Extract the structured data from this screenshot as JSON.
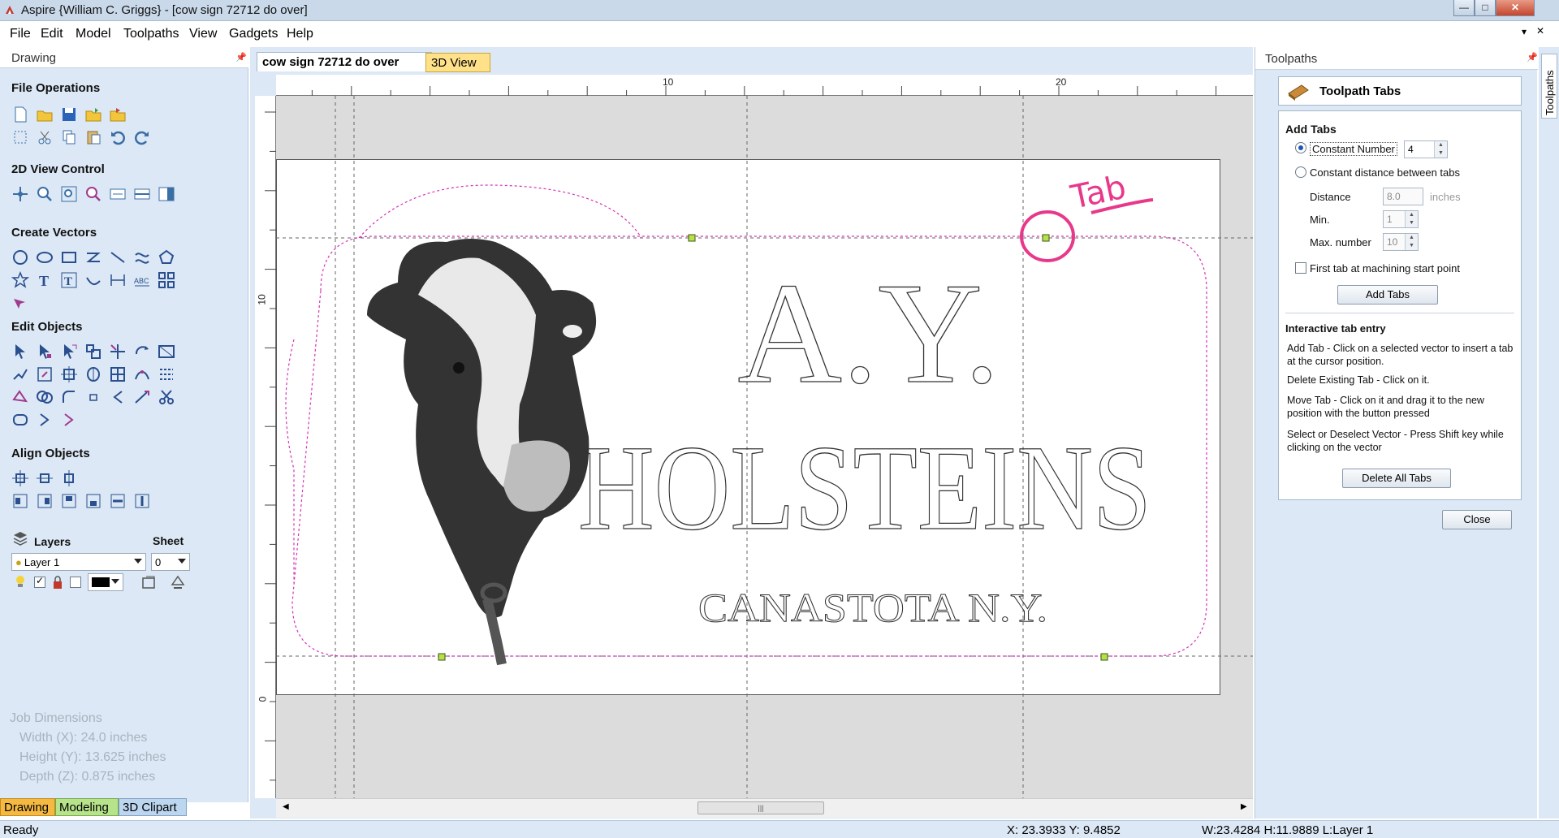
{
  "window": {
    "title": "Aspire {William C. Griggs} - [cow sign 72712 do over]"
  },
  "menu": [
    "File",
    "Edit",
    "Model",
    "Toolpaths",
    "View",
    "Gadgets",
    "Help"
  ],
  "left_panel": {
    "title": "Drawing",
    "sections": {
      "file_ops": "File Operations",
      "view_control": "2D View Control",
      "create_vectors": "Create Vectors",
      "edit_objects": "Edit Objects",
      "align_objects": "Align Objects"
    },
    "layers": {
      "label": "Layers",
      "sheet_label": "Sheet",
      "layer_value": "Layer 1",
      "sheet_value": "0"
    },
    "job_dimensions": {
      "title": "Job Dimensions",
      "width": "Width  (X): 24.0 inches",
      "height": "Height (Y): 13.625 inches",
      "depth": "Depth  (Z): 0.875 inches"
    },
    "bottom_tabs": [
      "Drawing",
      "Modeling",
      "3D Clipart"
    ]
  },
  "doc_tabs": [
    "cow sign 72712 do over",
    "3D View"
  ],
  "rulers": {
    "top": [
      "10",
      "20"
    ],
    "left": [
      "10",
      "0"
    ]
  },
  "sign": {
    "line1": "A.Y.",
    "line2": "HOLSTEINS",
    "line3": "CANASTOTA N.Y.",
    "annotation": "Tab"
  },
  "status": {
    "left": "Ready",
    "coords": "X: 23.3933 Y:  9.4852",
    "size": "W:23.4284   H:11.9889  L:Layer 1"
  },
  "right_panel": {
    "title": "Toolpaths",
    "side_tab": "Toolpaths",
    "tool_title": "Toolpath Tabs",
    "add_tabs": {
      "heading": "Add Tabs",
      "constant_number": "Constant Number",
      "constant_number_value": "4",
      "constant_distance": "Constant distance between tabs",
      "distance_label": "Distance",
      "distance_value": "8.0",
      "distance_unit": "inches",
      "min_label": "Min.",
      "min_value": "1",
      "max_label": "Max. number",
      "max_value": "10",
      "first_tab": "First tab at machining start point",
      "add_button": "Add Tabs"
    },
    "interactive": {
      "heading": "Interactive tab entry",
      "add": "Add Tab - Click on a selected vector to insert a tab at the cursor position.",
      "delete": "Delete Existing Tab - Click on it.",
      "move": "Move Tab - Click on it and drag it to the new position with the button pressed",
      "select": "Select or Deselect Vector - Press Shift key while clicking on the vector",
      "delete_all": "Delete All Tabs"
    },
    "close_button": "Close"
  }
}
